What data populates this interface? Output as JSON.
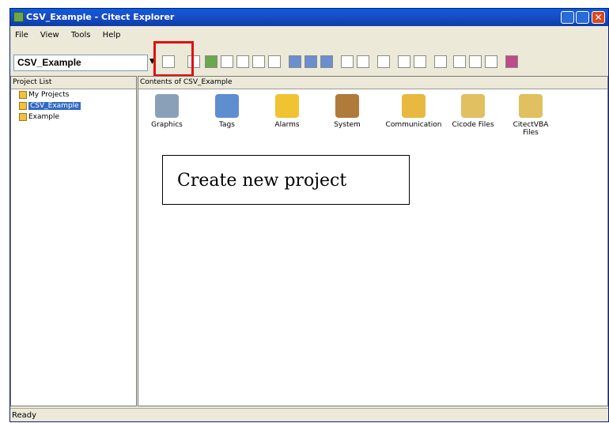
{
  "window": {
    "title": "CSV_Example - Citect Explorer"
  },
  "menu": [
    "File",
    "View",
    "Tools",
    "Help"
  ],
  "toolbar": {
    "project_value": "CSV_Example"
  },
  "left_pane": {
    "header": "Project List",
    "items": [
      {
        "label": "My Projects"
      },
      {
        "label": "CSV_Example"
      },
      {
        "label": "Example"
      }
    ]
  },
  "right_pane": {
    "header": "Contents of CSV_Example",
    "items": [
      {
        "label": "Graphics",
        "color": "#8aa0b8"
      },
      {
        "label": "Tags",
        "color": "#5d8ecf"
      },
      {
        "label": "Alarms",
        "color": "#f1c232"
      },
      {
        "label": "System",
        "color": "#b07a3a"
      },
      {
        "label": "Communication",
        "color": "#e8b840"
      },
      {
        "label": "Cicode Files",
        "color": "#e0c060"
      },
      {
        "label": "CitectVBA Files",
        "color": "#e0c060"
      }
    ]
  },
  "callout": {
    "text": "Create new project"
  },
  "status": {
    "text": "Ready"
  }
}
